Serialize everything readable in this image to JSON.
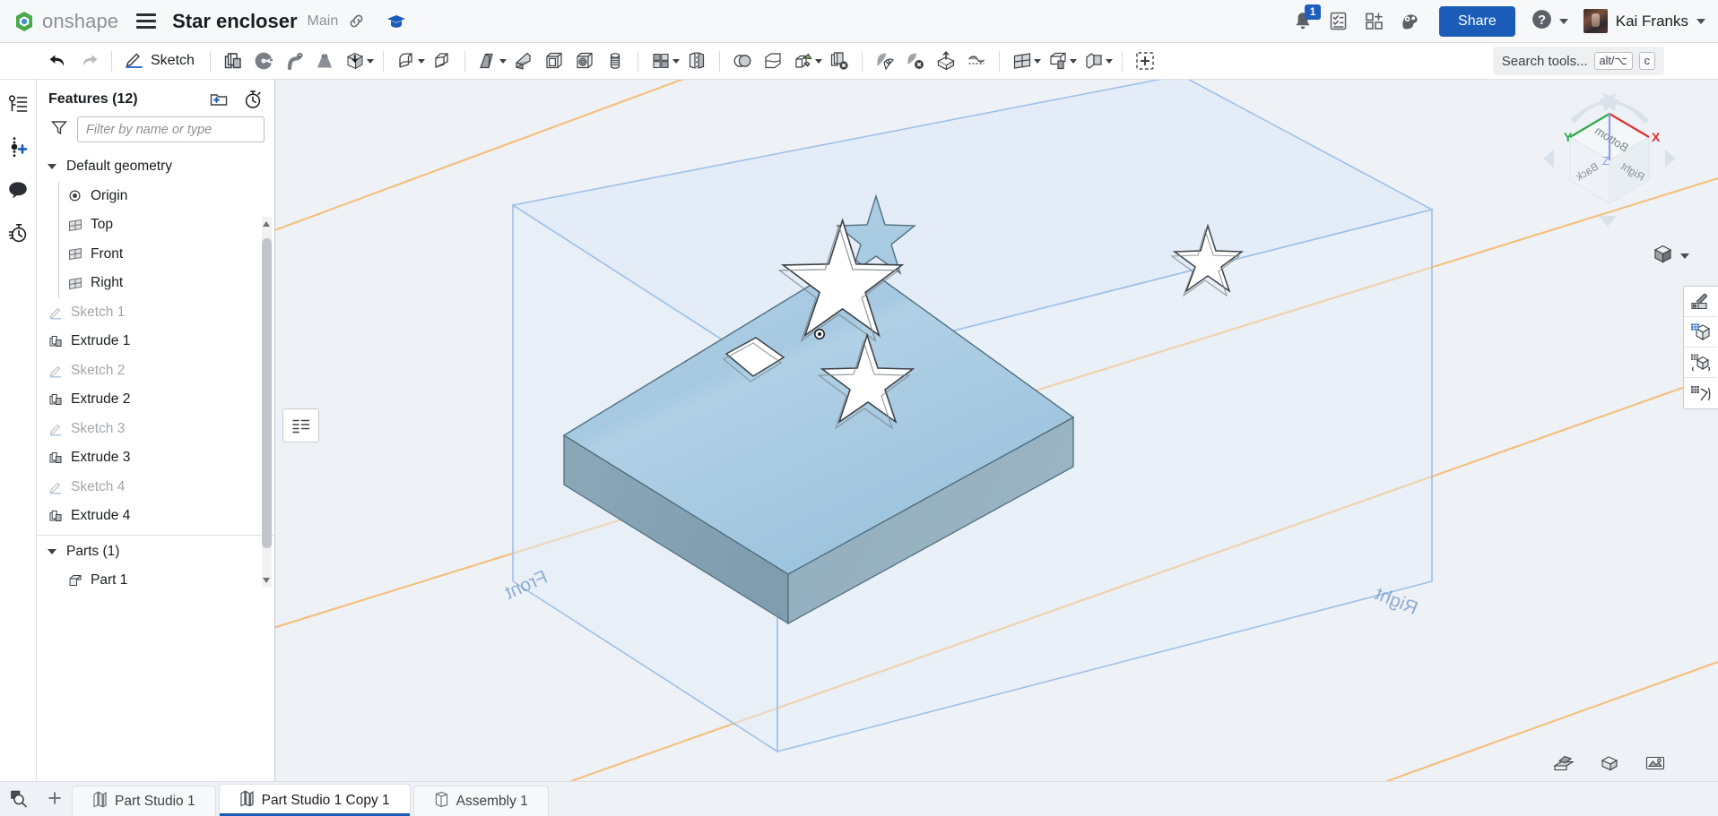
{
  "header": {
    "brand": "onshape",
    "menu_icon": "hamburger-icon",
    "document_title": "Star encloser",
    "branch": "Main",
    "link_icon": "link-icon",
    "learning_icon": "graduation-cap-icon",
    "notification_count": "1",
    "share_label": "Share",
    "user_name": "Kai Franks"
  },
  "toolbar": {
    "undo": "undo-icon",
    "redo": "redo-icon",
    "sketch_label": "Sketch",
    "search_placeholder": "Search tools...",
    "shortcut_modifier": "alt/⌥",
    "shortcut_key": "c"
  },
  "rail": {
    "items": [
      {
        "name": "feature-list-icon"
      },
      {
        "name": "add-point-icon"
      },
      {
        "name": "comments-icon"
      },
      {
        "name": "history-icon"
      }
    ]
  },
  "panel": {
    "title": "Features (12)",
    "new_folder_icon": "new-folder-icon",
    "rollback_icon": "stopwatch-icon",
    "filter_icon": "funnel-icon",
    "filter_placeholder": "Filter by name or type",
    "filter_value": "",
    "groups": [
      {
        "label": "Default geometry",
        "expanded": true,
        "items": [
          {
            "label": "Origin",
            "icon": "origin-icon",
            "muted": false
          },
          {
            "label": "Top",
            "icon": "plane-icon",
            "muted": false
          },
          {
            "label": "Front",
            "icon": "plane-icon",
            "muted": false
          },
          {
            "label": "Right",
            "icon": "plane-icon",
            "muted": false
          }
        ]
      }
    ],
    "features": [
      {
        "label": "Sketch 1",
        "icon": "sketch-icon",
        "muted": true
      },
      {
        "label": "Extrude 1",
        "icon": "extrude-icon",
        "muted": false
      },
      {
        "label": "Sketch 2",
        "icon": "sketch-icon",
        "muted": true
      },
      {
        "label": "Extrude 2",
        "icon": "extrude-icon",
        "muted": false
      },
      {
        "label": "Sketch 3",
        "icon": "sketch-icon",
        "muted": true
      },
      {
        "label": "Extrude 3",
        "icon": "extrude-icon",
        "muted": false
      },
      {
        "label": "Sketch 4",
        "icon": "sketch-icon",
        "muted": true
      },
      {
        "label": "Extrude 4",
        "icon": "extrude-icon",
        "muted": false
      }
    ],
    "parts": {
      "label": "Parts (1)",
      "expanded": true,
      "items": [
        {
          "label": "Part 1",
          "icon": "part-icon"
        }
      ]
    }
  },
  "viewport": {
    "background_color": "#eef1f5",
    "part_top_color": "#a8cbe2",
    "part_side_color": "#8aa7b8",
    "plane_color": "#9fc0e8",
    "axis_color": "#f5bd78",
    "plane_labels": [
      "Front",
      "Right"
    ],
    "origin_marker": "origin-point",
    "cutouts": [
      "star-large",
      "star-small",
      "star-medium",
      "diamond"
    ],
    "viewcube": {
      "faces": [
        "Bottom",
        "Back",
        "Right"
      ],
      "axes": [
        {
          "label": "X",
          "color": "#e03131"
        },
        {
          "label": "Y",
          "color": "#2bab4a"
        },
        {
          "label": "Z",
          "color": "#7b8ce0"
        }
      ]
    },
    "display_mode_icon": "shaded-cube-icon",
    "right_tools": [
      {
        "name": "appearance-icon"
      },
      {
        "name": "display-state-icon"
      },
      {
        "name": "transform-icon"
      },
      {
        "name": "measure-icon"
      }
    ],
    "bottom_icons": [
      {
        "name": "section-view-icon"
      },
      {
        "name": "zoom-to-fit-icon"
      },
      {
        "name": "render-icon"
      }
    ],
    "flyout_icon": "feature-list-flyout-icon"
  },
  "tabs": {
    "search_icon": "tab-search-icon",
    "add_label": "+",
    "items": [
      {
        "label": "Part Studio 1",
        "icon": "part-studio-icon",
        "active": false
      },
      {
        "label": "Part Studio 1 Copy 1",
        "icon": "part-studio-icon",
        "active": true
      },
      {
        "label": "Assembly 1",
        "icon": "assembly-icon",
        "active": false
      }
    ]
  }
}
